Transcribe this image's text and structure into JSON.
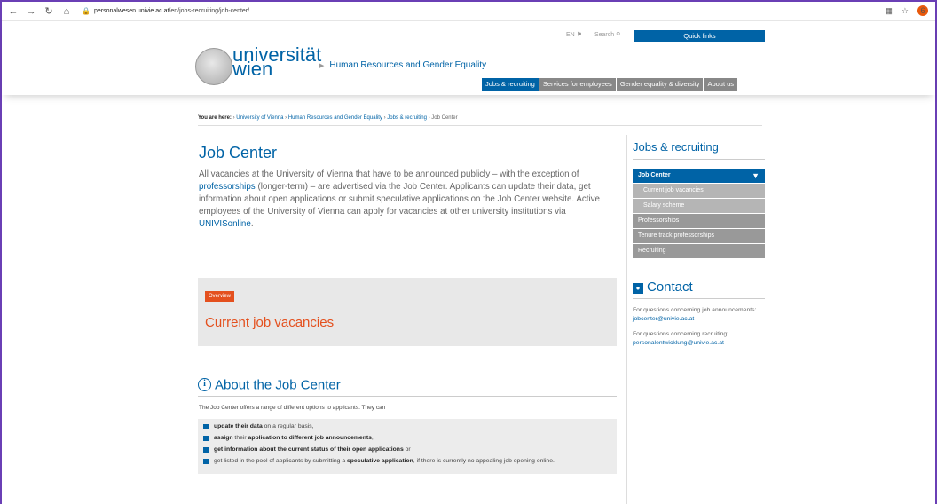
{
  "browser": {
    "url_host": "personalwesen.univie.ac.at",
    "url_path": "/en/jobs-recruiting/job-center/",
    "profile_initial": "6"
  },
  "header": {
    "lang": "EN",
    "search_label": "Search",
    "quick_links": "Quick links",
    "logo_line1": "universität",
    "logo_line2": "wien",
    "unit_link": "Human Resources and Gender Equality",
    "nav": [
      {
        "label": "Jobs & recruiting"
      },
      {
        "label": "Services for employees"
      },
      {
        "label": "Gender equality & diversity"
      },
      {
        "label": "About us"
      }
    ]
  },
  "breadcrumb": {
    "prefix": "You are here:",
    "items": [
      "University of Vienna",
      "Human Resources and Gender Equality",
      "Jobs & recruiting",
      "Job Center"
    ]
  },
  "main": {
    "title": "Job Center",
    "intro_1": "All vacancies at the University of Vienna that have to be announced publicly – with the exception of ",
    "intro_link1": "professorships",
    "intro_2": " (longer-term) – are advertised via the Job Center. Applicants can update their data, get information about open applications or submit speculative applications on the Job Center website. Active employees of the University of Vienna can apply for vacancies at other university institutions via ",
    "intro_link2": "UNIVISonline",
    "intro_3": ".",
    "overview_badge": "Overview",
    "overview_title": "Current job vacancies",
    "about_title": "About the Job Center",
    "about_intro": "The Job Center offers a range of different options to applicants. They can",
    "list": [
      {
        "b1": "update their data",
        "t1": " on a regular basis,",
        "b2": "",
        "t2": ""
      },
      {
        "b1": "assign",
        "t1": " their ",
        "b2": "application to different job announcements",
        "t2": ","
      },
      {
        "b1": "get information about the current status of their open applications",
        "t1": " or",
        "b2": "",
        "t2": ""
      },
      {
        "b1": "",
        "t1": "get listed in the pool of applicants by submitting a ",
        "b2": "speculative application",
        "t2": ", if there is currently no appealing job opening online."
      }
    ]
  },
  "sidebar": {
    "title": "Jobs & recruiting",
    "items": [
      {
        "label": "Job Center"
      },
      {
        "label": "Current job vacancies"
      },
      {
        "label": "Salary scheme"
      },
      {
        "label": "Professorships"
      },
      {
        "label": "Tenure track professorships"
      },
      {
        "label": "Recruiting"
      }
    ],
    "contact_title": "Contact",
    "contact_q1": "For questions concerning job announcements:",
    "contact_mail1": "jobcenter@univie.ac.at",
    "contact_q2": "For questions concerning recruiting:",
    "contact_mail2": "personalentwicklung@univie.ac.at"
  }
}
